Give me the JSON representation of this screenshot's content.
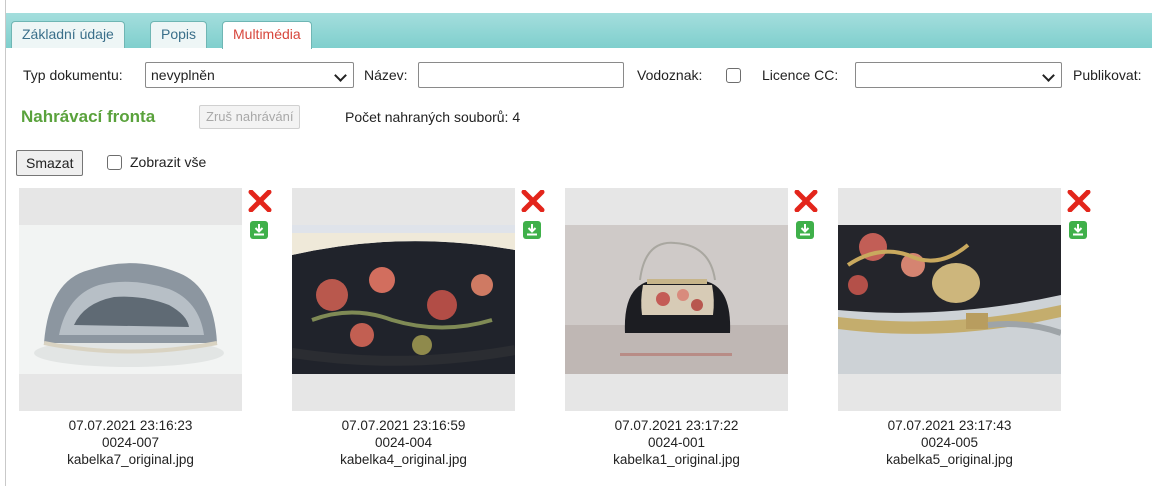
{
  "tabs": [
    {
      "label": "Základní údaje",
      "active": false
    },
    {
      "label": "Popis",
      "active": false
    },
    {
      "label": "Multimédia",
      "active": true
    }
  ],
  "filters": {
    "doc_type_label": "Typ dokumentu:",
    "doc_type_value": "nevyplněn",
    "name_label": "Název:",
    "name_value": "",
    "watermark_label": "Vodoznak:",
    "watermark_checked": false,
    "license_label": "Licence CC:",
    "license_value": "",
    "publish_label": "Publikovat:"
  },
  "upload_queue": {
    "title": "Nahrávací fronta",
    "cancel_button": "Zruš nahrávání",
    "count_text": "Počet nahraných souborů: 4"
  },
  "actions": {
    "delete_button": "Smazat",
    "show_all_label": "Zobrazit vše",
    "show_all_checked": false
  },
  "colors": {
    "tab_bar": "#8ed5d4",
    "active_tab_text": "#d7473d",
    "queue_title": "#5aa23c",
    "delete_icon": "#e3251b",
    "download_icon": "#3fb04a"
  },
  "gallery": [
    {
      "date": "07.07.2021 23:16:23",
      "code": "0024-007",
      "file": "kabelka7_original.jpg",
      "icons": [
        "close-icon",
        "download-icon"
      ]
    },
    {
      "date": "07.07.2021 23:16:59",
      "code": "0024-004",
      "file": "kabelka4_original.jpg",
      "icons": [
        "close-icon",
        "download-icon"
      ]
    },
    {
      "date": "07.07.2021 23:17:22",
      "code": "0024-001",
      "file": "kabelka1_original.jpg",
      "icons": [
        "close-icon",
        "download-icon"
      ]
    },
    {
      "date": "07.07.2021 23:17:43",
      "code": "0024-005",
      "file": "kabelka5_original.jpg",
      "icons": [
        "close-icon",
        "download-icon"
      ]
    }
  ]
}
